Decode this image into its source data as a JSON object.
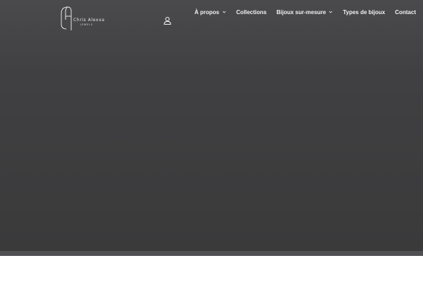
{
  "brand": {
    "name": "Chris Alexxa",
    "sub": "JEWELS",
    "monogram": "CA"
  },
  "header": {
    "account_icon": "user-icon",
    "nav": [
      {
        "label": "À propos",
        "has_dropdown": true
      },
      {
        "label": "Collections",
        "has_dropdown": false
      },
      {
        "label": "Bijoux sur-mesure",
        "has_dropdown": true
      },
      {
        "label": "Types de bijoux",
        "has_dropdown": false
      },
      {
        "label": "Contact",
        "has_dropdown": false
      }
    ]
  },
  "colors": {
    "hero_top": "#4a4a4c",
    "hero_bottom": "#3a3a3b",
    "nav_text": "#f2f2f2",
    "page_bg": "#ffffff"
  }
}
